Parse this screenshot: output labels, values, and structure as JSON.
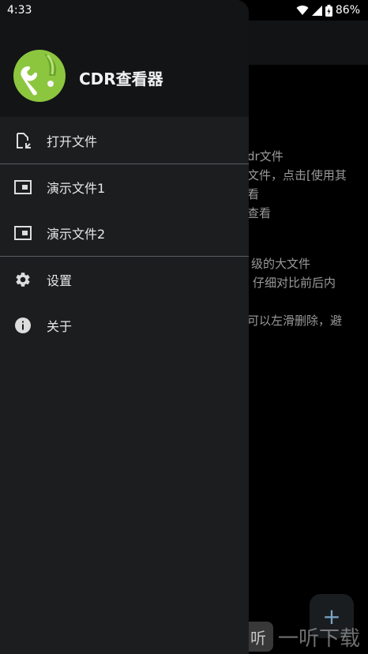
{
  "status_bar": {
    "time": "4:33",
    "battery": "86%"
  },
  "drawer": {
    "app_title": "CDR查看器",
    "items": [
      {
        "label": "打开文件",
        "icon": "open-file-icon"
      },
      {
        "label": "演示文件1",
        "icon": "slideshow-icon"
      },
      {
        "label": "演示文件2",
        "icon": "slideshow-icon"
      },
      {
        "label": "设置",
        "icon": "gear-icon"
      },
      {
        "label": "关于",
        "icon": "info-icon"
      }
    ]
  },
  "background": {
    "lines": [
      "dr文件",
      "文件，点击[使用其",
      "看",
      "查看",
      "级的大文件",
      "仔细对比前后内",
      "可以左滑删除，避"
    ],
    "fab_label": "+",
    "watermark": {
      "icon_text": "听",
      "text": "一听下载"
    }
  },
  "colors": {
    "drawer_bg": "#1b1d1f",
    "header_bg": "#121416",
    "logo_green": "#8cc63f"
  }
}
